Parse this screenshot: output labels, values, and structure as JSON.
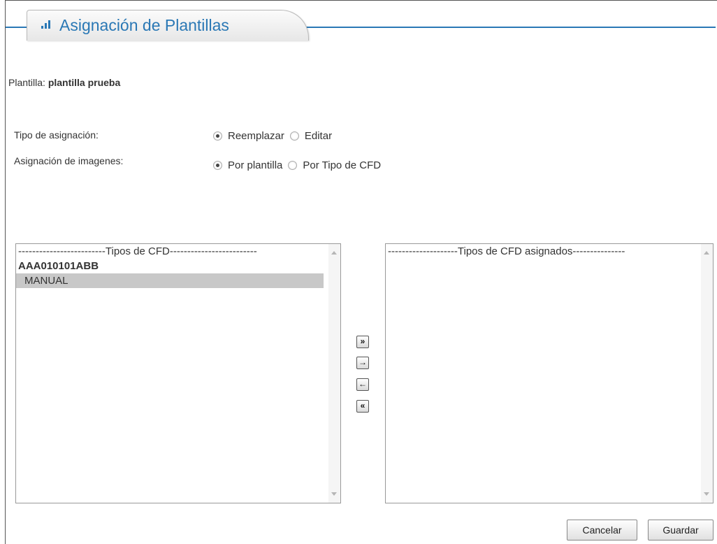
{
  "page": {
    "title": "Asignación de Plantillas",
    "plantilla_label": "Plantilla:",
    "plantilla_value": "plantilla prueba"
  },
  "options": {
    "tipo_asignacion": {
      "label": "Tipo de asignación:",
      "choices": [
        "Reemplazar",
        "Editar"
      ],
      "selected": "Reemplazar"
    },
    "asignacion_imagenes": {
      "label": "Asignación de imagenes:",
      "choices": [
        "Por plantilla",
        "Por Tipo de CFD"
      ],
      "selected": "Por plantilla"
    }
  },
  "lists": {
    "available": {
      "header": "-------------------------Tipos de CFD-------------------------",
      "group": "AAA010101ABB",
      "items": [
        "MANUAL"
      ]
    },
    "assigned": {
      "header": "--------------------Tipos de CFD asignados---------------"
    }
  },
  "movers": {
    "move_all_right": "»",
    "move_right": "→",
    "move_left": "←",
    "move_all_left": "«"
  },
  "buttons": {
    "cancel": "Cancelar",
    "save": "Guardar"
  },
  "colors": {
    "accent": "#2a78b5",
    "selected_item": "#c8c8c8"
  }
}
